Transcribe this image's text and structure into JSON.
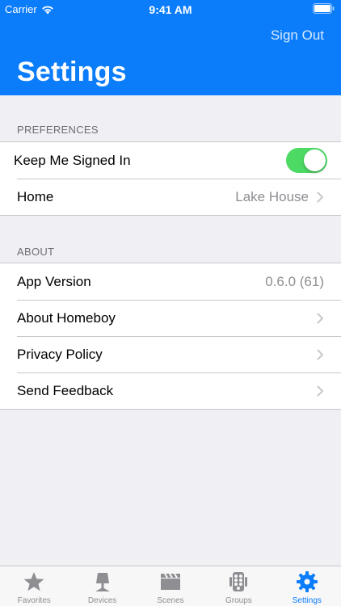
{
  "status_bar": {
    "carrier": "Carrier",
    "time": "9:41 AM"
  },
  "header": {
    "sign_out": "Sign Out",
    "title": "Settings",
    "background": "#0b7dfb"
  },
  "preferences": {
    "section_label": "PREFERENCES",
    "keep_signed_in": {
      "label": "Keep Me Signed In",
      "toggle_on": true
    },
    "home": {
      "label": "Home",
      "value": "Lake House"
    }
  },
  "about": {
    "section_label": "ABOUT",
    "app_version": {
      "label": "App Version",
      "value": "0.6.0 (61)"
    },
    "about_homeboy": {
      "label": "About Homeboy"
    },
    "privacy_policy": {
      "label": "Privacy Policy"
    },
    "send_feedback": {
      "label": "Send Feedback"
    }
  },
  "tabbar": {
    "tabs": [
      {
        "label": "Favorites",
        "icon": "star-icon"
      },
      {
        "label": "Devices",
        "icon": "device-icon"
      },
      {
        "label": "Scenes",
        "icon": "clapperboard-icon"
      },
      {
        "label": "Groups",
        "icon": "groups-icon"
      },
      {
        "label": "Settings",
        "icon": "gear-icon",
        "active": true
      }
    ]
  }
}
